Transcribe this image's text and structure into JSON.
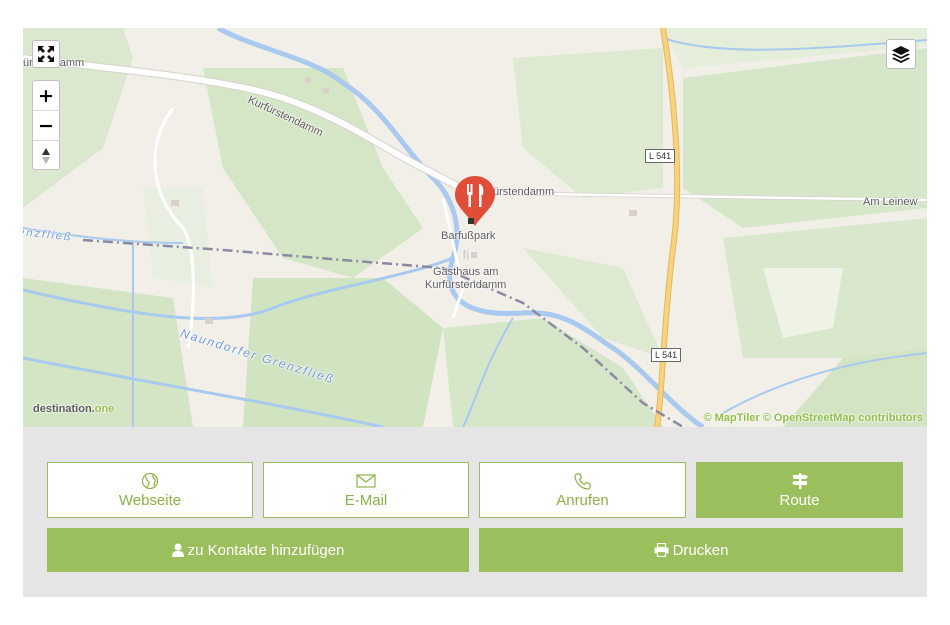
{
  "map": {
    "labels": {
      "kurf_left": "fürstendamm",
      "kurf_diag": "Kurfürstendamm",
      "kurf_right": "ürstendamm",
      "am_leinew": "Am Leinew",
      "barfusspark": "Barfußpark",
      "gasthaus_line1": "Gasthaus am",
      "gasthaus_line2": "Kurfürstendamm",
      "grenzfliess_left": "enzfließ",
      "naundorfer": "Naundorfer Grenzfließ",
      "road_l541_top": "L 541",
      "road_l541_bottom": "L 541"
    },
    "attribution": "© MapTiler © OpenStreetMap contributors",
    "logo_dark": "destination.",
    "logo_green": "one",
    "marker_icon": "restaurant-fork-knife-icon",
    "colors": {
      "marker": "#e04e39",
      "water": "#a9c9ef",
      "green": "#d6e7c9",
      "road_major": "#f2c466",
      "boundary": "#8a8aa0"
    }
  },
  "controls": {
    "fullscreen_icon": "expand-arrows-icon",
    "zoom_in": "+",
    "zoom_out": "−",
    "compass_icon": "compass-arrow-icon",
    "layers_icon": "layers-stack-icon"
  },
  "actions": {
    "website": {
      "label": "Webseite",
      "icon": "globe-icon"
    },
    "email": {
      "label": "E-Mail",
      "icon": "envelope-icon"
    },
    "call": {
      "label": "Anrufen",
      "icon": "phone-icon"
    },
    "route": {
      "label": "Route",
      "icon": "signpost-icon"
    },
    "contacts": {
      "label": "zu Kontakte hinzufügen",
      "icon": "user-icon"
    },
    "print": {
      "label": "Drucken",
      "icon": "printer-icon"
    }
  },
  "theme": {
    "accent": "#9cbf5d",
    "panel_bg": "#e5e5e5"
  }
}
